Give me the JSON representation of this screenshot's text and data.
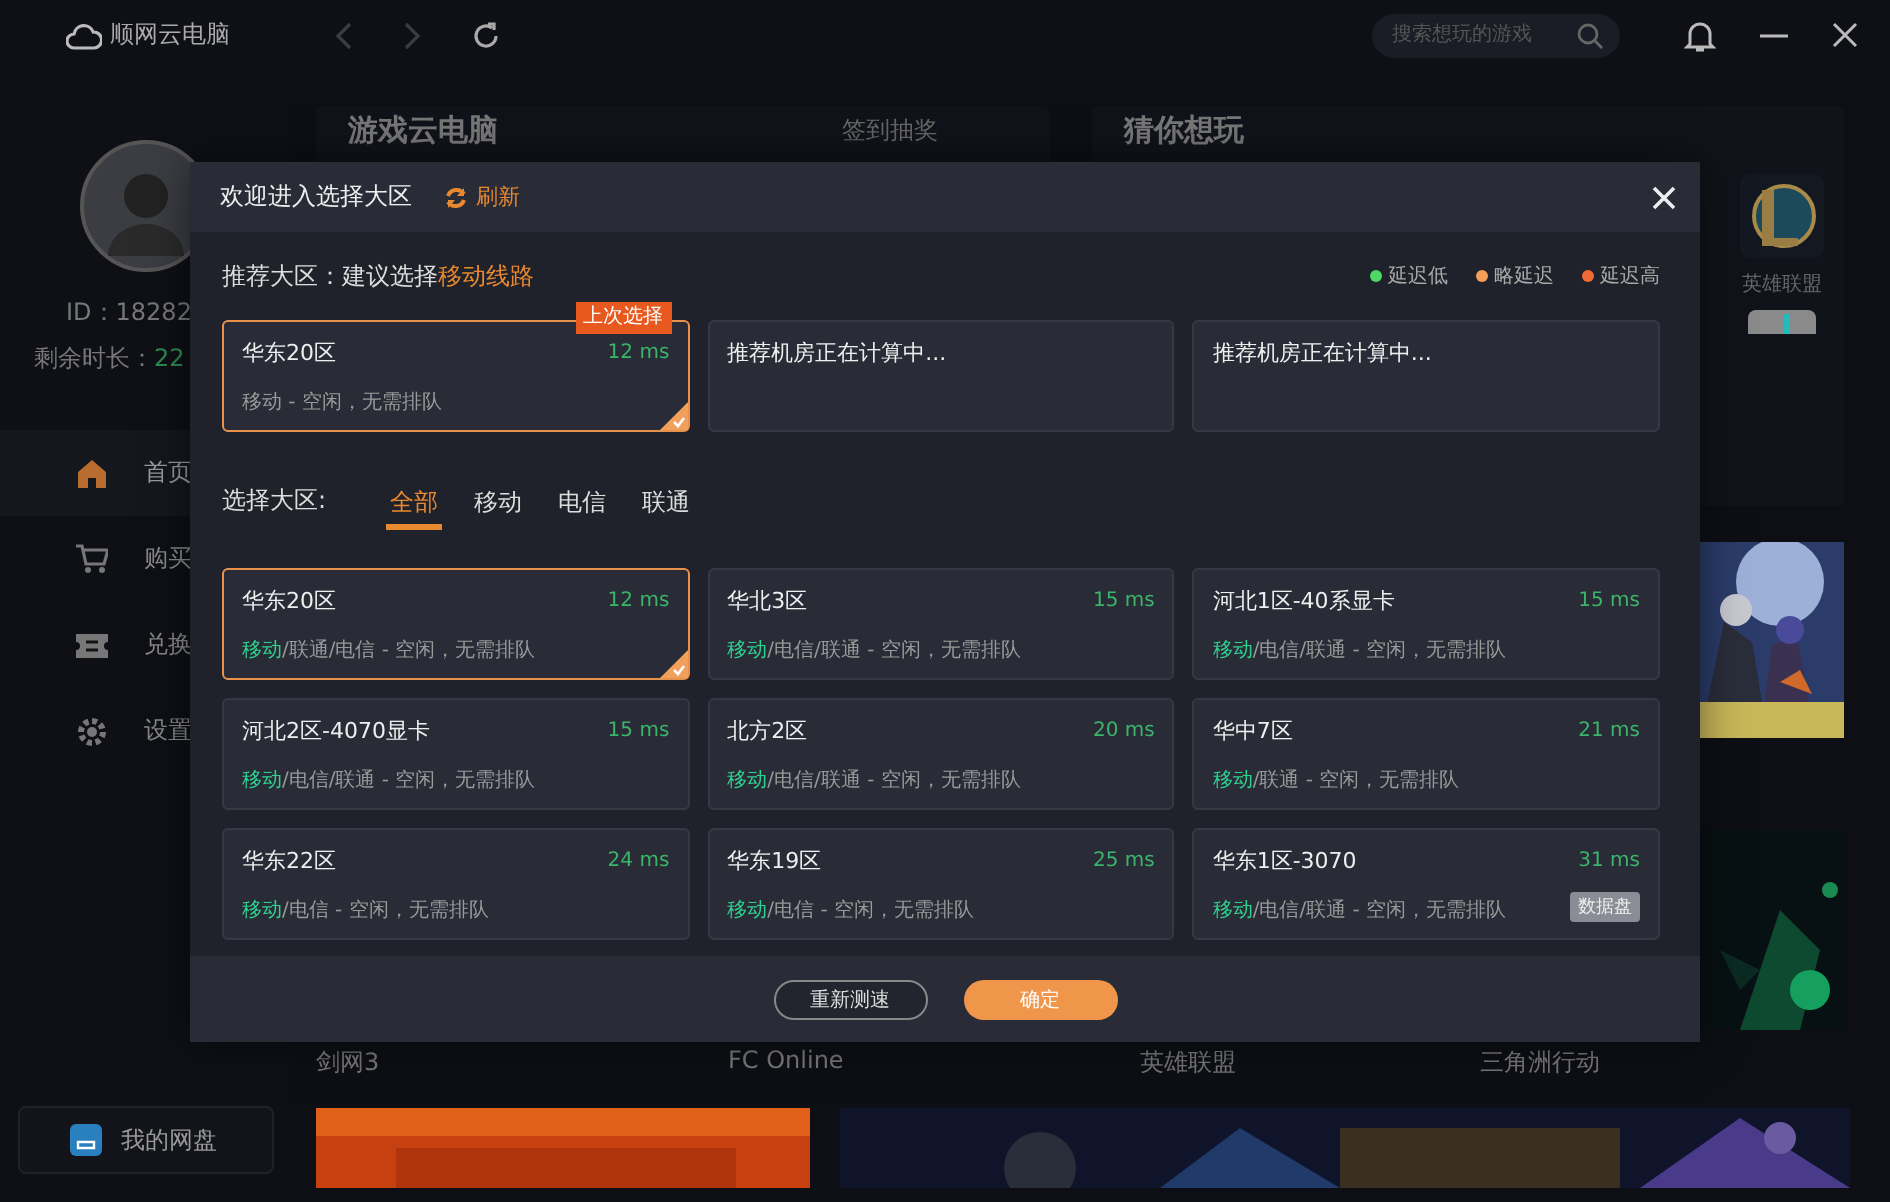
{
  "topbar": {
    "app_name": "顺网云电脑",
    "search": {
      "placeholder": "搜索想玩的游戏"
    }
  },
  "sidebar": {
    "user_id": "ID：18282",
    "time_label": "剩余时长：",
    "time_value": "22",
    "nav": [
      {
        "label": "首页",
        "selected": true
      },
      {
        "label": "购买",
        "selected": false
      },
      {
        "label": "兑换",
        "selected": false
      },
      {
        "label": "设置",
        "selected": false
      }
    ],
    "disk_button": "我的网盘"
  },
  "main": {
    "panel_left": {
      "title": "游戏云电脑",
      "action": "签到抽奖"
    },
    "panel_right": {
      "title": "猜你想玩",
      "game_label": "英雄联盟"
    },
    "game_labels": [
      "剑网3",
      "FC Online",
      "英雄联盟",
      "三角洲行动"
    ]
  },
  "dialog": {
    "title": "欢迎进入选择大区",
    "refresh": "刷新",
    "recommend_label": "推荐大区：建议选择",
    "recommend_route": "移动线路",
    "legend": [
      {
        "label": "延迟低",
        "color": "#4cd964"
      },
      {
        "label": "略延迟",
        "color": "#f5a05a"
      },
      {
        "label": "延迟高",
        "color": "#f06a35"
      }
    ],
    "recommended": [
      {
        "kind": "zone",
        "name": "华东20区",
        "latency": "12 ms",
        "status": "移动 - 空闲，无需排队",
        "badge": "上次选择",
        "selected": true
      },
      {
        "kind": "pending",
        "text": "推荐机房正在计算中..."
      },
      {
        "kind": "pending",
        "text": "推荐机房正在计算中..."
      }
    ],
    "filter_label": "选择大区:",
    "tabs": [
      {
        "label": "全部",
        "selected": true
      },
      {
        "label": "移动",
        "selected": false
      },
      {
        "label": "电信",
        "selected": false
      },
      {
        "label": "联通",
        "selected": false
      }
    ],
    "zones": [
      {
        "name": "华东20区",
        "latency": "12 ms",
        "line": "移动",
        "detail": "/联通/电信 - 空闲，无需排队",
        "selected": true
      },
      {
        "name": "华北3区",
        "latency": "15 ms",
        "line": "移动",
        "detail": "/电信/联通 - 空闲，无需排队",
        "selected": false
      },
      {
        "name": "河北1区-40系显卡",
        "latency": "15 ms",
        "line": "移动",
        "detail": "/电信/联通 - 空闲，无需排队",
        "selected": false
      },
      {
        "name": "河北2区-4070显卡",
        "latency": "15 ms",
        "line": "移动",
        "detail": "/电信/联通 - 空闲，无需排队",
        "selected": false
      },
      {
        "name": "北方2区",
        "latency": "20 ms",
        "line": "移动",
        "detail": "/电信/联通 - 空闲，无需排队",
        "selected": false
      },
      {
        "name": "华中7区",
        "latency": "21 ms",
        "line": "移动",
        "detail": "/联通 - 空闲，无需排队",
        "selected": false
      },
      {
        "name": "华东22区",
        "latency": "24 ms",
        "line": "移动",
        "detail": "/电信 - 空闲，无需排队",
        "selected": false
      },
      {
        "name": "华东19区",
        "latency": "25 ms",
        "line": "移动",
        "detail": "/电信 - 空闲，无需排队",
        "selected": false
      },
      {
        "name": "华东1区-3070",
        "latency": "31 ms",
        "line": "移动",
        "detail": "/电信/联通 - 空闲，无需排队",
        "tag": "数据盘",
        "selected": false
      }
    ],
    "buttons": {
      "retest": "重新测速",
      "confirm": "确定"
    }
  }
}
